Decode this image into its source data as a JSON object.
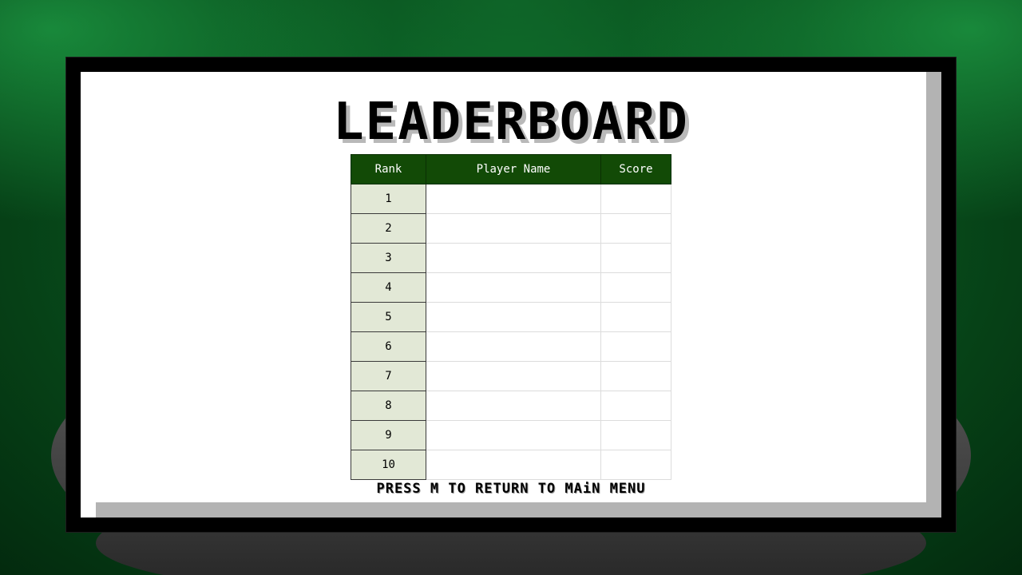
{
  "screen": {
    "title": "LEADERBOARD",
    "prompt": "PRESS M TO RETURN TO MAiN MENU"
  },
  "table": {
    "headers": {
      "rank": "Rank",
      "player_name": "Player Name",
      "score": "Score"
    },
    "rows": [
      {
        "rank": "1",
        "player_name": "",
        "score": ""
      },
      {
        "rank": "2",
        "player_name": "",
        "score": ""
      },
      {
        "rank": "3",
        "player_name": "",
        "score": ""
      },
      {
        "rank": "4",
        "player_name": "",
        "score": ""
      },
      {
        "rank": "5",
        "player_name": "",
        "score": ""
      },
      {
        "rank": "6",
        "player_name": "",
        "score": ""
      },
      {
        "rank": "7",
        "player_name": "",
        "score": ""
      },
      {
        "rank": "8",
        "player_name": "",
        "score": ""
      },
      {
        "rank": "9",
        "player_name": "",
        "score": ""
      },
      {
        "rank": "10",
        "player_name": "",
        "score": ""
      }
    ]
  },
  "colors": {
    "felt": "#0a5a22",
    "header_bg": "#124a06",
    "rank_cell_bg": "#e2e8d6",
    "panel_bg": "#ffffff",
    "panel_shadow": "#b3b3b3",
    "frame": "#000000"
  }
}
